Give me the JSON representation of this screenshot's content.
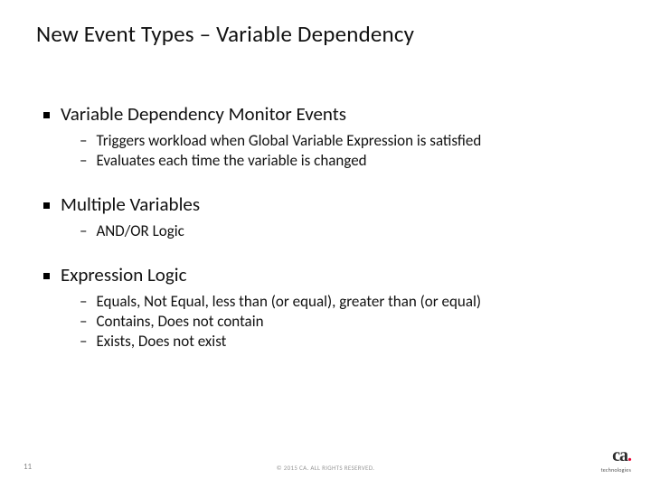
{
  "title": "New Event Types – Variable Dependency",
  "sections": [
    {
      "heading": "Variable Dependency Monitor Events",
      "items": [
        "Triggers workload when Global Variable Expression is satisfied",
        "Evaluates each time the variable is changed"
      ]
    },
    {
      "heading": "Multiple Variables",
      "items": [
        "AND/OR Logic"
      ]
    },
    {
      "heading": "Expression Logic",
      "items": [
        "Equals, Not Equal, less than (or equal), greater than (or equal)",
        "Contains, Does not contain",
        "Exists, Does not exist"
      ]
    }
  ],
  "footer": {
    "page_number": "11",
    "copyright": "© 2015 CA. ALL RIGHTS RESERVED.",
    "logo_main": "ca",
    "logo_sub": "technologies"
  }
}
